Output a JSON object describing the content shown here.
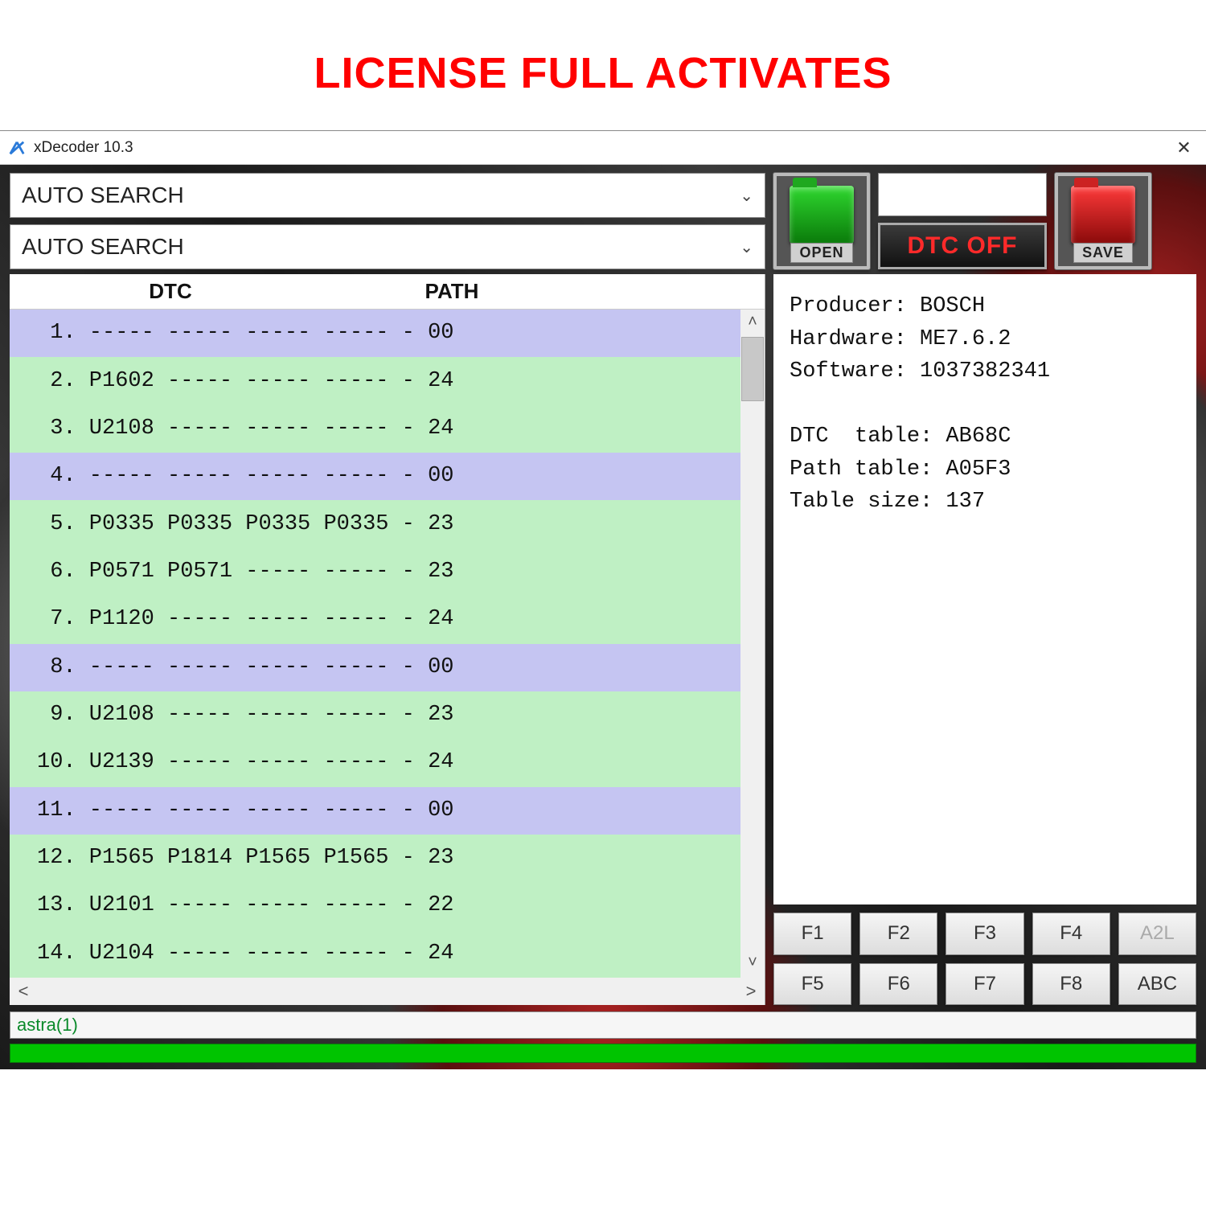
{
  "banner": "LICENSE FULL ACTIVATES",
  "window": {
    "title": "xDecoder 10.3"
  },
  "dropdowns": {
    "top": "AUTO SEARCH",
    "bottom": "AUTO SEARCH"
  },
  "buttons": {
    "open": "OPEN",
    "save": "SAVE",
    "dtc_off": "DTC OFF"
  },
  "table": {
    "head_dtc": "DTC",
    "head_path": "PATH",
    "rows": [
      {
        "n": " 1",
        "text": "----- ----- ----- ----- - 00",
        "cls": "purple"
      },
      {
        "n": " 2",
        "text": "P1602 ----- ----- ----- - 24",
        "cls": "green"
      },
      {
        "n": " 3",
        "text": "U2108 ----- ----- ----- - 24",
        "cls": "green"
      },
      {
        "n": " 4",
        "text": "----- ----- ----- ----- - 00",
        "cls": "purple"
      },
      {
        "n": " 5",
        "text": "P0335 P0335 P0335 P0335 - 23",
        "cls": "green"
      },
      {
        "n": " 6",
        "text": "P0571 P0571 ----- ----- - 23",
        "cls": "green"
      },
      {
        "n": " 7",
        "text": "P1120 ----- ----- ----- - 24",
        "cls": "green"
      },
      {
        "n": " 8",
        "text": "----- ----- ----- ----- - 00",
        "cls": "purple"
      },
      {
        "n": " 9",
        "text": "U2108 ----- ----- ----- - 23",
        "cls": "green"
      },
      {
        "n": "10",
        "text": "U2139 ----- ----- ----- - 24",
        "cls": "green"
      },
      {
        "n": "11",
        "text": "----- ----- ----- ----- - 00",
        "cls": "purple"
      },
      {
        "n": "12",
        "text": "P1565 P1814 P1565 P1565 - 23",
        "cls": "green"
      },
      {
        "n": "13",
        "text": "U2101 ----- ----- ----- - 22",
        "cls": "green"
      },
      {
        "n": "14",
        "text": "U2104 ----- ----- ----- - 24",
        "cls": "green"
      }
    ]
  },
  "info": {
    "producer_label": "Producer:",
    "producer_value": "BOSCH",
    "hardware_label": "Hardware:",
    "hardware_value": "ME7.6.2",
    "software_label": "Software:",
    "software_value": "1037382341",
    "dtc_table_label": "DTC  table:",
    "dtc_table_value": "AB68C",
    "path_table_label": "Path table:",
    "path_table_value": "A05F3",
    "table_size_label": "Table size:",
    "table_size_value": "137"
  },
  "fkeys": [
    "F1",
    "F2",
    "F3",
    "F4",
    "A2L",
    "F5",
    "F6",
    "F7",
    "F8",
    "ABC"
  ],
  "fkeys_disabled": [
    4
  ],
  "status": "astra(1)"
}
